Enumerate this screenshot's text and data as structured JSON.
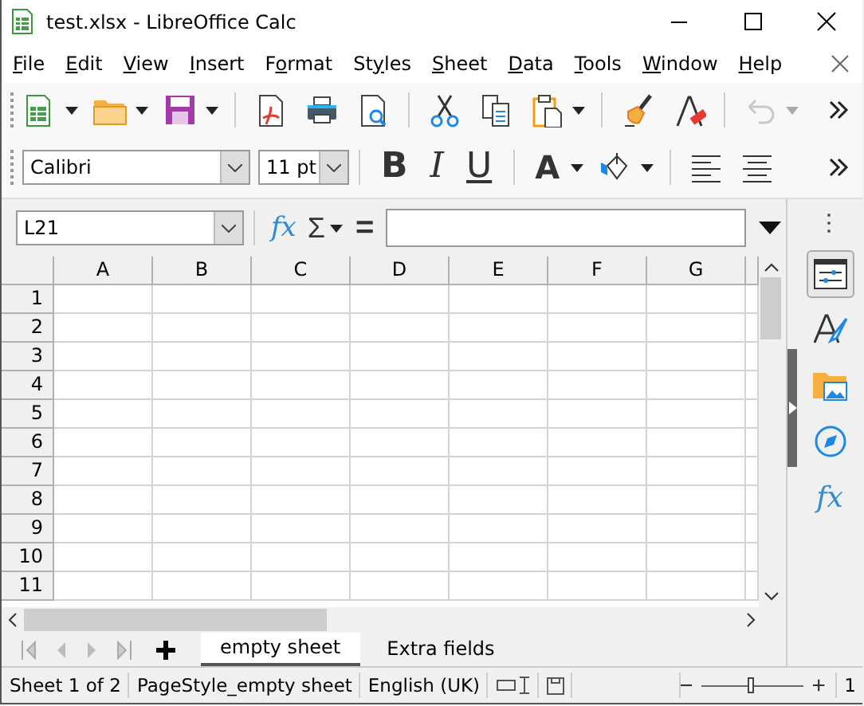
{
  "window": {
    "title": "test.xlsx - LibreOffice Calc"
  },
  "menu": [
    {
      "key": "F",
      "post": "ile"
    },
    {
      "key": "E",
      "post": "dit"
    },
    {
      "key": "V",
      "post": "iew"
    },
    {
      "key": "I",
      "post": "nsert"
    },
    {
      "pre": "F",
      "key": "o",
      "post": "rmat"
    },
    {
      "pre": "St",
      "key": "y",
      "post": "les"
    },
    {
      "key": "S",
      "post": "heet"
    },
    {
      "key": "D",
      "post": "ata"
    },
    {
      "key": "T",
      "post": "ools"
    },
    {
      "key": "W",
      "post": "indow"
    },
    {
      "key": "H",
      "post": "elp"
    }
  ],
  "standard_toolbar": [
    {
      "kind": "new",
      "dropdown": true,
      "disabled": false
    },
    {
      "kind": "open",
      "dropdown": true,
      "disabled": false
    },
    {
      "kind": "save",
      "dropdown": true,
      "disabled": false
    },
    {
      "kind": "sep"
    },
    {
      "kind": "pdf",
      "dropdown": false,
      "disabled": false
    },
    {
      "kind": "print",
      "dropdown": false,
      "disabled": false
    },
    {
      "kind": "preview",
      "dropdown": false,
      "disabled": false
    },
    {
      "kind": "sep"
    },
    {
      "kind": "cut",
      "dropdown": false,
      "disabled": false
    },
    {
      "kind": "copy",
      "dropdown": false,
      "disabled": false
    },
    {
      "kind": "paste",
      "dropdown": true,
      "disabled": false
    },
    {
      "kind": "sep"
    },
    {
      "kind": "clone",
      "dropdown": false,
      "disabled": false
    },
    {
      "kind": "clear",
      "dropdown": false,
      "disabled": false
    },
    {
      "kind": "sep"
    },
    {
      "kind": "undo",
      "dropdown": true,
      "disabled": true
    }
  ],
  "formatting_toolbar": {
    "font_name": "Calibri",
    "font_size": "11 pt",
    "style_buttons": [
      {
        "kind": "bold",
        "label": "B"
      },
      {
        "kind": "italic",
        "label": "I"
      },
      {
        "kind": "underline",
        "label": "U"
      }
    ],
    "font_color_label": "A"
  },
  "formula_bar": {
    "name_box": "L21",
    "function_wizard": "fx",
    "sum": "Σ",
    "equals": "="
  },
  "sheet": {
    "columns": [
      "A",
      "B",
      "C",
      "D",
      "E",
      "F",
      "G"
    ],
    "rows": [
      "1",
      "2",
      "3",
      "4",
      "5",
      "6",
      "7",
      "8",
      "9",
      "10",
      "11"
    ]
  },
  "sheet_tabs": [
    {
      "label": "empty sheet",
      "selected": true
    },
    {
      "label": "Extra fields",
      "selected": false
    }
  ],
  "sidebar": {
    "buttons": [
      {
        "kind": "properties",
        "selected": true
      },
      {
        "kind": "styles",
        "selected": false
      },
      {
        "kind": "gallery",
        "selected": false
      },
      {
        "kind": "navigator",
        "selected": false
      },
      {
        "kind": "functions",
        "selected": false,
        "label": "fx"
      }
    ]
  },
  "status_bar": {
    "sheet": "Sheet 1 of 2",
    "page_style": "PageStyle_empty sheet",
    "language": "English (UK)",
    "zoom": {
      "level": 0.49
    },
    "zoom_text": "1"
  }
}
